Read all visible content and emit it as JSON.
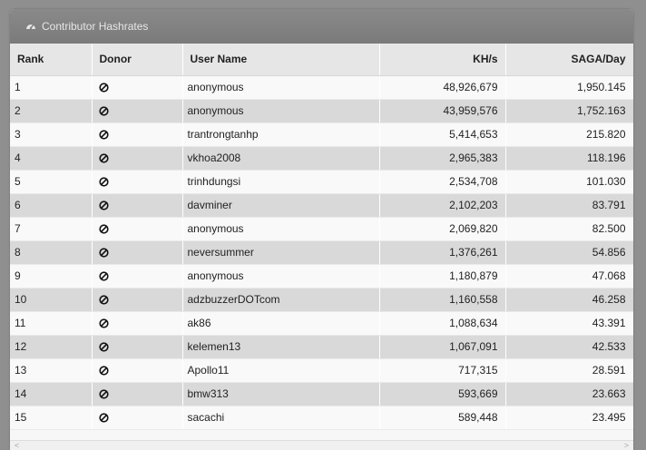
{
  "panel": {
    "title": "Contributor Hashrates",
    "icon": "dashboard-icon"
  },
  "table": {
    "columns": [
      "Rank",
      "Donor",
      "User Name",
      "KH/s",
      "SAGA/Day"
    ],
    "rows": [
      {
        "rank": "1",
        "user": "anonymous",
        "khs": "48,926,679",
        "saga": "1,950.145"
      },
      {
        "rank": "2",
        "user": "anonymous",
        "khs": "43,959,576",
        "saga": "1,752.163"
      },
      {
        "rank": "3",
        "user": "trantrongtanhp",
        "khs": "5,414,653",
        "saga": "215.820"
      },
      {
        "rank": "4",
        "user": "vkhoa2008",
        "khs": "2,965,383",
        "saga": "118.196"
      },
      {
        "rank": "5",
        "user": "trinhdungsi",
        "khs": "2,534,708",
        "saga": "101.030"
      },
      {
        "rank": "6",
        "user": "davminer",
        "khs": "2,102,203",
        "saga": "83.791"
      },
      {
        "rank": "7",
        "user": "anonymous",
        "khs": "2,069,820",
        "saga": "82.500"
      },
      {
        "rank": "8",
        "user": "neversummer",
        "khs": "1,376,261",
        "saga": "54.856"
      },
      {
        "rank": "9",
        "user": "anonymous",
        "khs": "1,180,879",
        "saga": "47.068"
      },
      {
        "rank": "10",
        "user": "adzbuzzerDOTcom",
        "khs": "1,160,558",
        "saga": "46.258"
      },
      {
        "rank": "11",
        "user": "ak86",
        "khs": "1,088,634",
        "saga": "43.391"
      },
      {
        "rank": "12",
        "user": "kelemen13",
        "khs": "1,067,091",
        "saga": "42.533"
      },
      {
        "rank": "13",
        "user": "Apollo11",
        "khs": "717,315",
        "saga": "28.591"
      },
      {
        "rank": "14",
        "user": "bmw313",
        "khs": "593,669",
        "saga": "23.663"
      },
      {
        "rank": "15",
        "user": "sacachi",
        "khs": "589,448",
        "saga": "23.495"
      }
    ],
    "donor_icon": "not-donor-icon"
  },
  "scrollbar": {
    "left_arrow": "<",
    "right_arrow": ">"
  }
}
